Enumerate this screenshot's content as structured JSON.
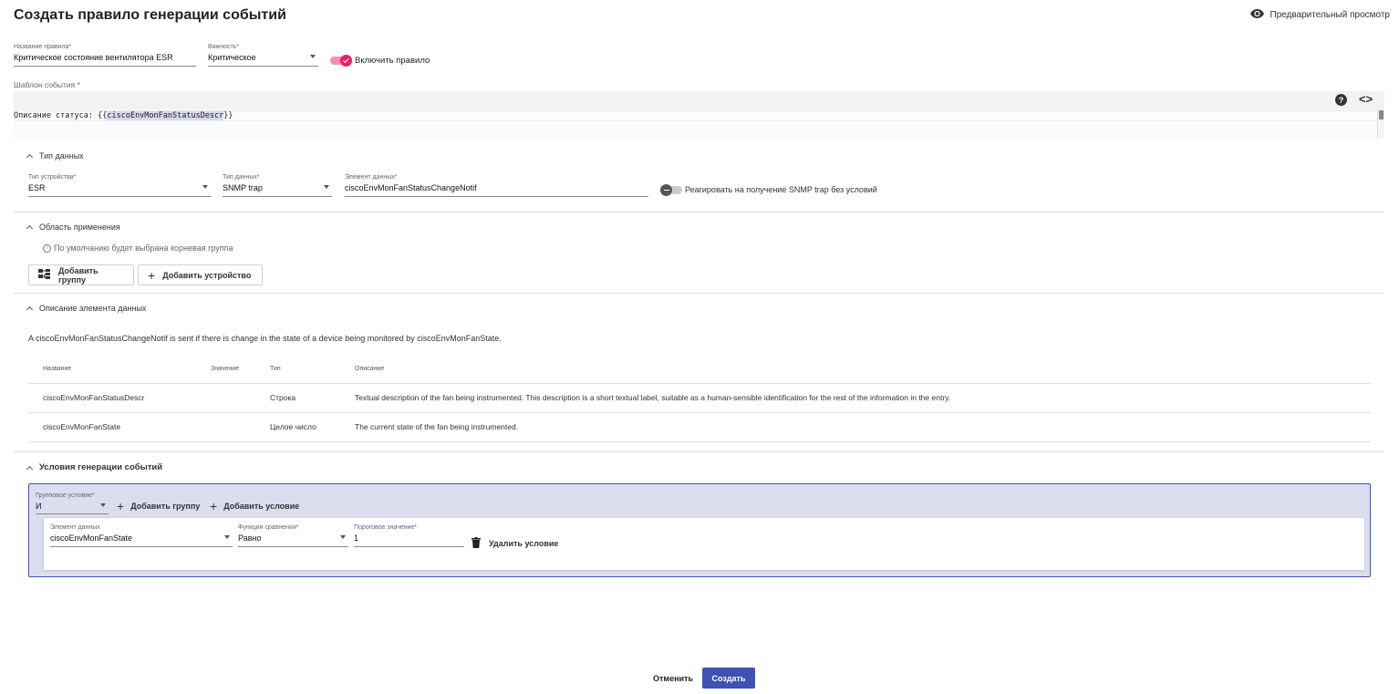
{
  "page": {
    "title": "Создать правило генерации событий",
    "preview_label": "Предварительный просмотр",
    "icons": {
      "preview": "eye-icon"
    }
  },
  "rule": {
    "name_label": "Название правила*",
    "name_value": "Критическое состояние вентилятора ESR",
    "severity_label": "Важность*",
    "severity_value": "Критическое",
    "enable_label": "Включить правило",
    "enable_on": true
  },
  "template": {
    "label": "Шаблон события *",
    "code_prefix": "Описание статуса: {{",
    "code_var": "ciscoEnvMonFanStatusDescr",
    "code_suffix": "}}",
    "icons": {
      "help": "help-icon",
      "code": "code-icon"
    }
  },
  "data_type_section": {
    "title": "Тип данных",
    "device_type_label": "Тип устройства*",
    "device_type_value": "ESR",
    "data_type_label": "Тип данных*",
    "data_type_value": "SNMP trap",
    "data_element_label": "Элемент данных*",
    "data_element_value": "ciscoEnvMonFanStatusChangeNotif",
    "react_label": "Реагировать на получение SNMP trap без условий",
    "react_on": false
  },
  "scope_section": {
    "title": "Область применения",
    "hint": "По умолчанию будет выбрана корневая группа",
    "add_group_label": "Добавить группу",
    "add_device_label": "Добавить устройство",
    "icons": {
      "info": "info-icon",
      "group": "group-tree-icon",
      "add": "plus-icon"
    }
  },
  "description_section": {
    "title": "Описание элемента данных",
    "text": "A ciscoEnvMonFanStatusChangeNotif is sent if there is change in the state of a device being monitored by ciscoEnvMonFanState.",
    "columns": [
      "Название",
      "Значение",
      "Тип",
      "Описание"
    ],
    "rows": [
      {
        "name": "ciscoEnvMonFanStatusDescr",
        "value": "",
        "type": "Строка",
        "description": "Textual description of the fan being instrumented. This description is a short textual label, suitable as a human-sensible identification for the rest of the information in the entry."
      },
      {
        "name": "ciscoEnvMonFanState",
        "value": "",
        "type": "Целое число",
        "description": "The current state of the fan being instrumented."
      }
    ]
  },
  "conditions_section": {
    "title": "Условия генерации событий",
    "group_condition_label": "Групповое условие*",
    "group_condition_value": "И",
    "add_group_label": "Добавить группу",
    "add_condition_label": "Добавить условие",
    "condition": {
      "element_label": "Элемент данных",
      "element_value": "ciscoEnvMonFanState",
      "func_label": "Функция сравнения*",
      "func_value": "Равно",
      "threshold_label": "Пороговое значение*",
      "threshold_value": "1",
      "delete_label": "Удалить условие"
    },
    "icons": {
      "add": "plus-icon",
      "delete": "trash-icon"
    }
  },
  "footer": {
    "cancel_label": "Отменить",
    "create_label": "Создать"
  },
  "colors": {
    "accent": "#3f51b5",
    "toggle_on": "#e91e63",
    "conditions_bg": "#dcdef0"
  }
}
